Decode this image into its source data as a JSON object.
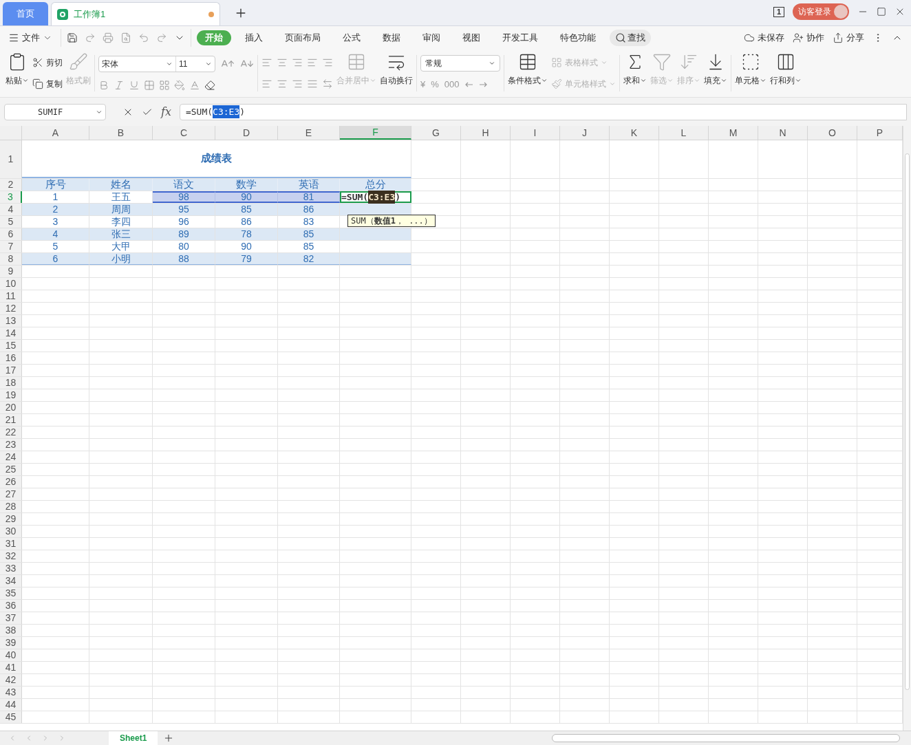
{
  "app_tabs": [
    {
      "label": "首页",
      "kind": "home",
      "selected": false,
      "modified": false
    },
    {
      "label": "工作簿1",
      "kind": "doc",
      "selected": true,
      "modified": true
    }
  ],
  "window": {
    "count": "1",
    "login": "访客登录"
  },
  "menu": {
    "file": "文件",
    "tabs": [
      {
        "label": "开始",
        "selected": true
      },
      {
        "label": "插入",
        "selected": false
      },
      {
        "label": "页面布局",
        "selected": false
      },
      {
        "label": "公式",
        "selected": false
      },
      {
        "label": "数据",
        "selected": false
      },
      {
        "label": "审阅",
        "selected": false
      },
      {
        "label": "视图",
        "selected": false
      },
      {
        "label": "开发工具",
        "selected": false
      },
      {
        "label": "特色功能",
        "selected": false
      }
    ],
    "search": "查找",
    "save_status": "未保存",
    "collaborate": "协作",
    "share": "分享"
  },
  "ribbon": {
    "paste": {
      "label": "粘贴",
      "disabled": false
    },
    "cut": {
      "label": "剪切",
      "disabled": false
    },
    "copy": {
      "label": "复制",
      "disabled": false
    },
    "format_painter": {
      "label": "格式刷",
      "disabled": true
    },
    "font_name": "宋体",
    "font_size": "11",
    "merge": {
      "label": "合并居中",
      "disabled": true
    },
    "wrap": {
      "label": "自动换行",
      "disabled": false
    },
    "number_format": "常规",
    "number_symbols": [
      "¥",
      "%",
      "000"
    ],
    "conditional": {
      "label": "条件格式",
      "disabled": false
    },
    "table_style": {
      "label": "表格样式",
      "disabled": true
    },
    "cell_style": {
      "label": "单元格样式",
      "disabled": true
    },
    "sum": {
      "label": "求和",
      "disabled": false
    },
    "filter": {
      "label": "筛选",
      "disabled": true
    },
    "sort": {
      "label": "排序",
      "disabled": true
    },
    "fill": {
      "label": "填充",
      "disabled": false
    },
    "cell": {
      "label": "单元格",
      "disabled": false
    },
    "rowcol": {
      "label": "行和列",
      "disabled": false
    }
  },
  "formula_bar": {
    "name_box": "SUMIF",
    "fx": "fx",
    "prefix": "=SUM(",
    "ref": "C3:E3",
    "suffix": ")"
  },
  "sheet": {
    "columns": [
      {
        "label": "A",
        "selected": false
      },
      {
        "label": "B",
        "selected": false
      },
      {
        "label": "C",
        "selected": false
      },
      {
        "label": "D",
        "selected": false
      },
      {
        "label": "E",
        "selected": false
      },
      {
        "label": "F",
        "selected": true
      },
      {
        "label": "G",
        "selected": false
      },
      {
        "label": "H",
        "selected": false
      },
      {
        "label": "I",
        "selected": false
      },
      {
        "label": "J",
        "selected": false
      },
      {
        "label": "K",
        "selected": false
      },
      {
        "label": "L",
        "selected": false
      },
      {
        "label": "M",
        "selected": false
      },
      {
        "label": "N",
        "selected": false
      },
      {
        "label": "O",
        "selected": false
      },
      {
        "label": "P",
        "selected": false
      }
    ],
    "row_headers": [
      {
        "label": "1",
        "selected": false
      },
      {
        "label": "2",
        "selected": false
      },
      {
        "label": "3",
        "selected": true
      },
      {
        "label": "4",
        "selected": false
      },
      {
        "label": "5",
        "selected": false
      },
      {
        "label": "6",
        "selected": false
      },
      {
        "label": "7",
        "selected": false
      },
      {
        "label": "8",
        "selected": false
      },
      {
        "label": "9",
        "selected": false
      },
      {
        "label": "10",
        "selected": false
      },
      {
        "label": "11",
        "selected": false
      },
      {
        "label": "12",
        "selected": false
      },
      {
        "label": "13",
        "selected": false
      },
      {
        "label": "14",
        "selected": false
      },
      {
        "label": "15",
        "selected": false
      },
      {
        "label": "16",
        "selected": false
      },
      {
        "label": "17",
        "selected": false
      },
      {
        "label": "18",
        "selected": false
      },
      {
        "label": "19",
        "selected": false
      },
      {
        "label": "20",
        "selected": false
      },
      {
        "label": "21",
        "selected": false
      },
      {
        "label": "22",
        "selected": false
      },
      {
        "label": "23",
        "selected": false
      },
      {
        "label": "24",
        "selected": false
      },
      {
        "label": "25",
        "selected": false
      },
      {
        "label": "26",
        "selected": false
      },
      {
        "label": "27",
        "selected": false
      },
      {
        "label": "28",
        "selected": false
      },
      {
        "label": "29",
        "selected": false
      },
      {
        "label": "30",
        "selected": false
      },
      {
        "label": "31",
        "selected": false
      },
      {
        "label": "32",
        "selected": false
      },
      {
        "label": "33",
        "selected": false
      },
      {
        "label": "34",
        "selected": false
      },
      {
        "label": "35",
        "selected": false
      },
      {
        "label": "36",
        "selected": false
      },
      {
        "label": "37",
        "selected": false
      },
      {
        "label": "38",
        "selected": false
      },
      {
        "label": "39",
        "selected": false
      },
      {
        "label": "40",
        "selected": false
      },
      {
        "label": "41",
        "selected": false
      },
      {
        "label": "42",
        "selected": false
      },
      {
        "label": "43",
        "selected": false
      },
      {
        "label": "44",
        "selected": false
      },
      {
        "label": "45",
        "selected": false
      }
    ],
    "title": "成绩表",
    "header": [
      "序号",
      "姓名",
      "语文",
      "数学",
      "英语",
      "总分"
    ],
    "records": [
      {
        "banded": false,
        "cells": [
          {
            "text": "1",
            "selected": false
          },
          {
            "text": "王五",
            "selected": false
          },
          {
            "text": "98",
            "selected": true
          },
          {
            "text": "90",
            "selected": true
          },
          {
            "text": "81",
            "selected": true
          }
        ]
      },
      {
        "banded": true,
        "cells": [
          {
            "text": "2",
            "selected": false
          },
          {
            "text": "周周",
            "selected": false
          },
          {
            "text": "95",
            "selected": false
          },
          {
            "text": "85",
            "selected": false
          },
          {
            "text": "86",
            "selected": false
          }
        ]
      },
      {
        "banded": false,
        "cells": [
          {
            "text": "3",
            "selected": false
          },
          {
            "text": "李四",
            "selected": false
          },
          {
            "text": "96",
            "selected": false
          },
          {
            "text": "86",
            "selected": false
          },
          {
            "text": "83",
            "selected": false
          }
        ]
      },
      {
        "banded": true,
        "cells": [
          {
            "text": "4",
            "selected": false
          },
          {
            "text": "张三",
            "selected": false
          },
          {
            "text": "89",
            "selected": false
          },
          {
            "text": "78",
            "selected": false
          },
          {
            "text": "85",
            "selected": false
          }
        ]
      },
      {
        "banded": false,
        "cells": [
          {
            "text": "5",
            "selected": false
          },
          {
            "text": "大甲",
            "selected": false
          },
          {
            "text": "80",
            "selected": false
          },
          {
            "text": "90",
            "selected": false
          },
          {
            "text": "85",
            "selected": false
          }
        ]
      },
      {
        "banded": true,
        "cells": [
          {
            "text": "6",
            "selected": false
          },
          {
            "text": "小明",
            "selected": false
          },
          {
            "text": "88",
            "selected": false
          },
          {
            "text": "79",
            "selected": false
          },
          {
            "text": "82",
            "selected": false
          }
        ]
      }
    ],
    "editor": {
      "prefix": "=SUM(",
      "ref": "C3:E3",
      "suffix": ")"
    },
    "tooltip": "SUM（**数值1**， ...）"
  },
  "sheet_tabs": [
    {
      "label": "Sheet1",
      "selected": true
    }
  ]
}
